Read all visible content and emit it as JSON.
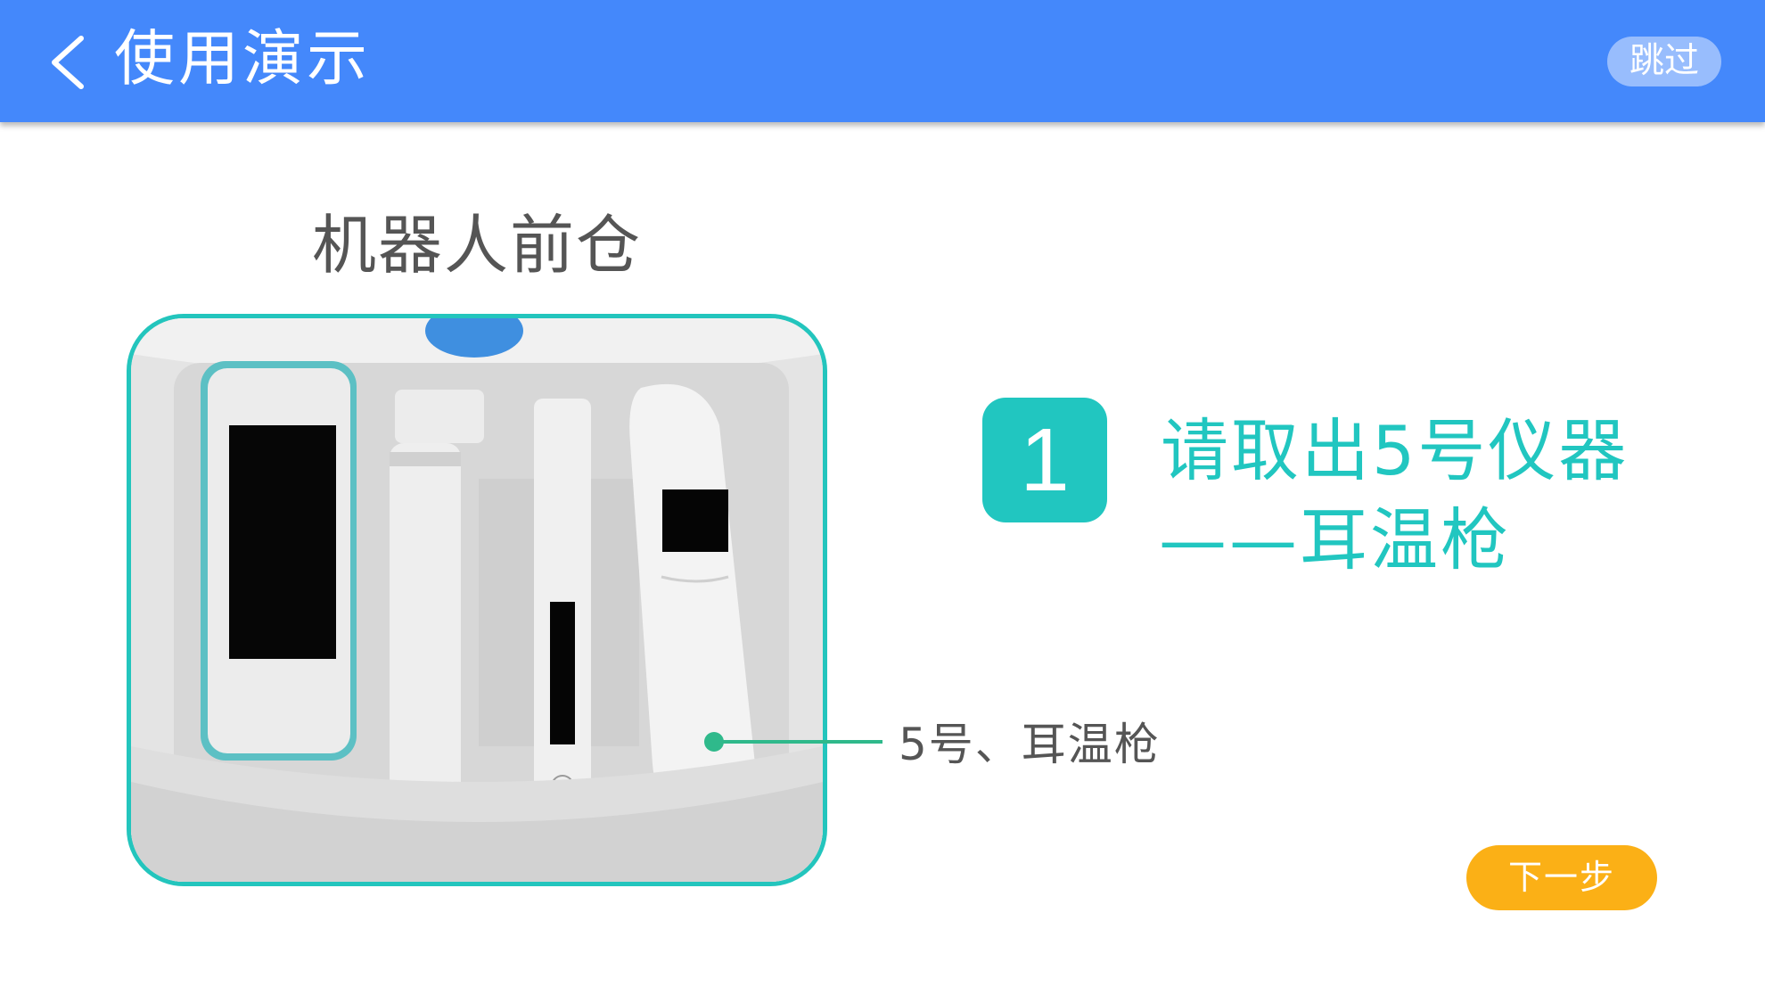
{
  "header": {
    "title": "使用演示",
    "skip_label": "跳过",
    "back_icon": "chevron-left-icon",
    "bar_color": "#4488fb"
  },
  "panel": {
    "title": "机器人前仓",
    "image_description_label": "5号、耳温枪",
    "frame_color": "#23c5bd"
  },
  "step": {
    "number": "1",
    "line1": "请取出5号仪器",
    "line2": "——耳温枪",
    "accent_color": "#21c6c0"
  },
  "footer": {
    "next_label": "下一步",
    "next_color": "#fbb016"
  }
}
